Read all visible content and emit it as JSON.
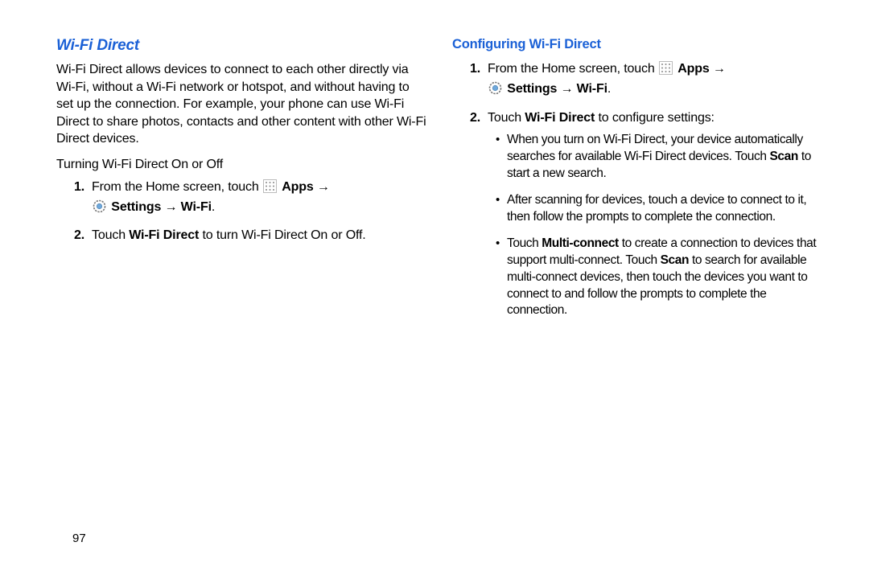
{
  "pageNumber": "97",
  "left": {
    "heading": "Wi-Fi Direct",
    "intro": "Wi-Fi Direct allows devices to connect to each other directly via Wi-Fi, without a Wi-Fi network or hotspot, and without having to set up the connection. For example, your phone can use Wi-Fi Direct to share photos, contacts and other content with other Wi-Fi Direct devices.",
    "subhead": "Turning Wi-Fi Direct On or Off",
    "step1_pre": "From the Home screen, touch ",
    "apps_label": "Apps",
    "settings_label": "Settings",
    "wifi_label": "Wi-Fi",
    "arrow": "→",
    "period": ".",
    "step2_pre": "Touch ",
    "step2_bold": "Wi-Fi Direct",
    "step2_post": " to turn Wi-Fi Direct On or Off."
  },
  "right": {
    "heading": "Configuring Wi-Fi Direct",
    "step1_pre": "From the Home screen, touch ",
    "apps_label": "Apps",
    "settings_label": "Settings",
    "wifi_label": "Wi-Fi",
    "arrow": "→",
    "period": ".",
    "step2_pre": "Touch ",
    "step2_bold": "Wi-Fi Direct",
    "step2_post": " to configure settings:",
    "b1_a": "When you turn on Wi-Fi Direct, your device automatically searches for available Wi-Fi Direct devices. Touch  ",
    "b1_bold": "Scan",
    "b1_b": " to start a new search.",
    "b2": "After scanning for devices, touch a device to connect to it, then follow the prompts to complete the connection.",
    "b3_a": "Touch ",
    "b3_bold1": "Multi-connect",
    "b3_b": " to create a connection to devices that support multi-connect. Touch ",
    "b3_bold2": "Scan",
    "b3_c": " to search for available multi-connect devices, then touch the devices you want to connect to and follow the prompts to complete the connection."
  },
  "numbers": {
    "one": "1.",
    "two": "2."
  }
}
